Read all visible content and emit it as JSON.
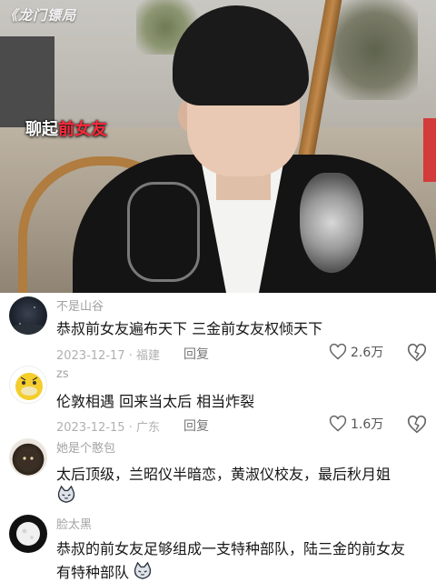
{
  "video": {
    "watermark": "《龙门镖局",
    "caption_plain": "聊起",
    "caption_highlight": "前女友"
  },
  "comments": [
    {
      "username": "不是山谷",
      "text": "恭叔前女友遍布天下  三金前女友权倾天下",
      "date": "2023-12-17",
      "location": "福建",
      "reply_label": "回复",
      "likes": "2.6万",
      "avatar_icon": "dark-night-avatar-icon"
    },
    {
      "username": "zs",
      "text": "伦敦相遇  回来当太后  相当炸裂",
      "date": "2023-12-15",
      "location": "广东",
      "reply_label": "回复",
      "likes": "1.6万",
      "avatar_icon": "yellow-duck-avatar-icon"
    },
    {
      "username": "她是个憨包",
      "text": "太后顶级，兰昭仪半暗恋，黄淑仪校友，最后秋月姐",
      "avatar_icon": "cat-avatar-icon",
      "sticker_icon": "cat-sticker-icon"
    },
    {
      "username": "脸太黑",
      "text": "恭叔的前女友足够组成一支特种部队，陆三金的前女友",
      "text_line2": "有特种部队",
      "avatar_icon": "white-moon-avatar-icon",
      "sticker_icon": "cat-sticker-icon"
    }
  ],
  "colors": {
    "caption_highlight": "#ff2a3c",
    "username": "#a3a3a3",
    "content": "#161616",
    "meta": "#b0b0b0"
  }
}
